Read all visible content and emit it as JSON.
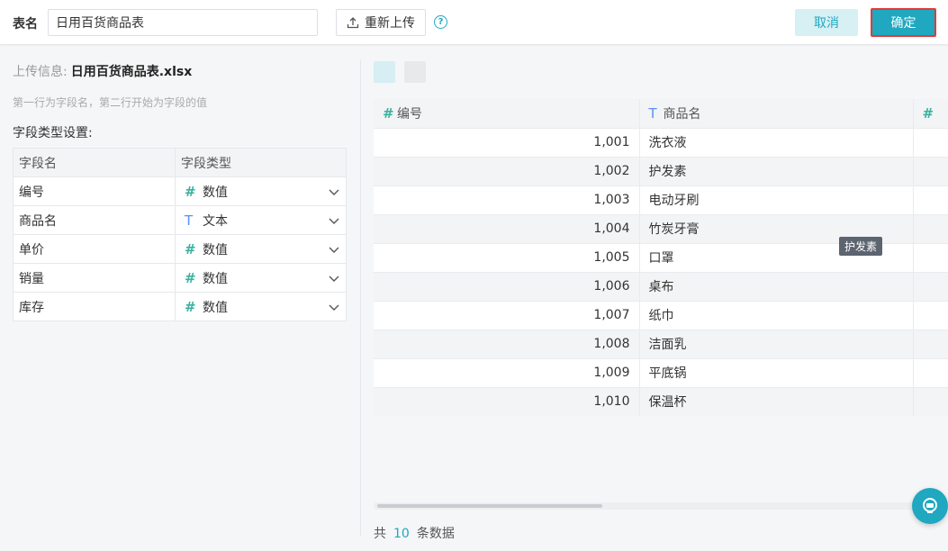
{
  "topbar": {
    "table_name_label": "表名",
    "table_name_value": "日用百货商品表",
    "reupload_label": "重新上传",
    "help_icon": "?",
    "cancel_label": "取消",
    "confirm_label": "确定"
  },
  "left": {
    "upload_info_label": "上传信息:",
    "upload_file_name": "日用百货商品表.xlsx",
    "hint": "第一行为字段名，第二行开始为字段的值",
    "field_setting_label": "字段类型设置:",
    "columns": [
      "字段名",
      "字段类型"
    ],
    "fields": [
      {
        "name": "编号",
        "type": "数值",
        "icon": "hash-icon"
      },
      {
        "name": "商品名",
        "type": "文本",
        "icon": "text-t-icon"
      },
      {
        "name": "单价",
        "type": "数值",
        "icon": "hash-icon"
      },
      {
        "name": "销量",
        "type": "数值",
        "icon": "hash-icon"
      },
      {
        "name": "库存",
        "type": "数值",
        "icon": "hash-icon"
      }
    ]
  },
  "right": {
    "columns": [
      "编号",
      "商品名"
    ],
    "rows": [
      {
        "id": "1,001",
        "name": "洗衣液"
      },
      {
        "id": "1,002",
        "name": "护发素"
      },
      {
        "id": "1,003",
        "name": "电动牙刷"
      },
      {
        "id": "1,004",
        "name": "竹炭牙膏"
      },
      {
        "id": "1,005",
        "name": "口罩"
      },
      {
        "id": "1,006",
        "name": "桌布"
      },
      {
        "id": "1,007",
        "name": "纸巾"
      },
      {
        "id": "1,008",
        "name": "洁面乳"
      },
      {
        "id": "1,009",
        "name": "平底锅"
      },
      {
        "id": "1,010",
        "name": "保温杯"
      }
    ],
    "tooltip": "护发素",
    "footer_prefix": "共",
    "footer_count": "10",
    "footer_suffix": "条数据"
  },
  "colors": {
    "accent": "#1fa8c0",
    "confirm_border": "#e53935",
    "number_icon": "#3bb2a0",
    "text_icon": "#5b8ff9"
  }
}
